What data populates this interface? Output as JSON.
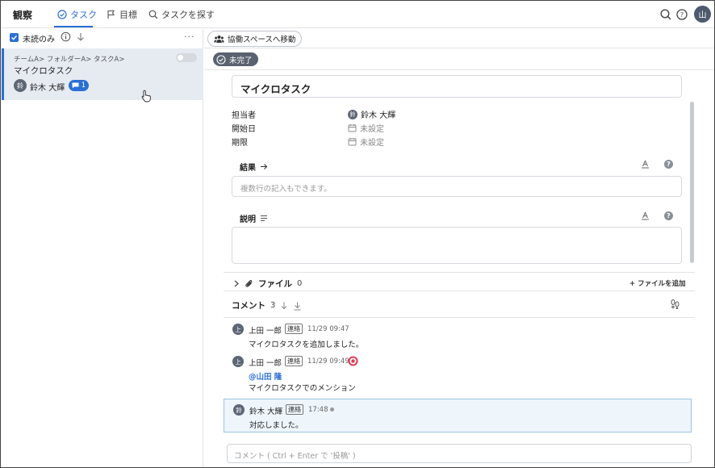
{
  "header": {
    "app_title": "観察",
    "tabs": [
      {
        "label": "タスク",
        "icon": "check-circle-icon",
        "active": true
      },
      {
        "label": "目標",
        "icon": "flag-icon",
        "active": false
      },
      {
        "label": "タスクを探す",
        "icon": "search-icon",
        "active": false
      }
    ],
    "user_initial": "山",
    "accent_color": "#2b6fd6"
  },
  "left_pane": {
    "unread_only_label": "未読のみ",
    "more_label": "···",
    "task": {
      "breadcrumb": "チームA> フォルダーA> タスクA>",
      "title": "マイクロタスク",
      "assignee_initial": "鈴",
      "assignee": "鈴木 大輝",
      "comment_count": "1"
    }
  },
  "right_pane": {
    "move_button_label": "協働スペースへ移動",
    "status_label": "未完了",
    "task_title": "マイクロタスク",
    "fields": {
      "assignee_label": "担当者",
      "assignee_initial": "鈴",
      "assignee_value": "鈴木 大輝",
      "start_label": "開始日",
      "start_value": "未設定",
      "due_label": "期限",
      "due_value": "未設定"
    },
    "result": {
      "label": "結果",
      "placeholder": "複数行の記入もできます。"
    },
    "description": {
      "label": "説明"
    },
    "files": {
      "label": "ファイル",
      "count": "0",
      "add_label": "+ ファイルを追加"
    },
    "comments": {
      "label": "コメント",
      "count": "3",
      "items": [
        {
          "initial": "上",
          "author": "上田 一郎",
          "tag": "連絡",
          "time": "11/29 09:47",
          "mention": "",
          "text": "マイクロタスクを追加しました。"
        },
        {
          "initial": "上",
          "author": "上田 一郎",
          "tag": "連絡",
          "time": "11/29 09:49",
          "mention": "@山田 隆",
          "text": "マイクロタスクでのメンション"
        },
        {
          "initial": "鈴",
          "author": "鈴木 大輝",
          "tag": "連絡",
          "time": "17:48",
          "mention": "",
          "text": "対応しました。"
        }
      ]
    },
    "comment_input_placeholder": "コメント ( Ctrl + Enter で '投稿' )"
  }
}
